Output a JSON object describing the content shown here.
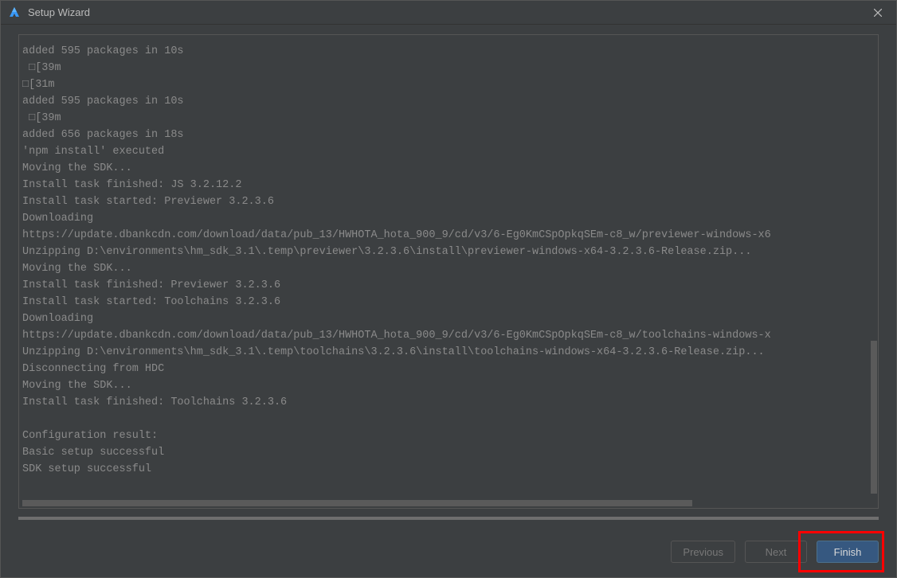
{
  "window": {
    "title": "Setup Wizard"
  },
  "log": {
    "lines": [
      "added 595 packages in 10s",
      " □[39m",
      "□[31m",
      "added 595 packages in 10s",
      " □[39m",
      "added 656 packages in 18s",
      "'npm install' executed",
      "Moving the SDK...",
      "Install task finished: JS 3.2.12.2",
      "Install task started: Previewer 3.2.3.6",
      "Downloading",
      "https://update.dbankcdn.com/download/data/pub_13/HWHOTA_hota_900_9/cd/v3/6-Eg0KmCSpOpkqSEm-c8_w/previewer-windows-x6",
      "Unzipping D:\\environments\\hm_sdk_3.1\\.temp\\previewer\\3.2.3.6\\install\\previewer-windows-x64-3.2.3.6-Release.zip...",
      "Moving the SDK...",
      "Install task finished: Previewer 3.2.3.6",
      "Install task started: Toolchains 3.2.3.6",
      "Downloading",
      "https://update.dbankcdn.com/download/data/pub_13/HWHOTA_hota_900_9/cd/v3/6-Eg0KmCSpOpkqSEm-c8_w/toolchains-windows-x",
      "Unzipping D:\\environments\\hm_sdk_3.1\\.temp\\toolchains\\3.2.3.6\\install\\toolchains-windows-x64-3.2.3.6-Release.zip...",
      "Disconnecting from HDC",
      "Moving the SDK...",
      "Install task finished: Toolchains 3.2.3.6",
      "",
      "Configuration result:",
      "Basic setup successful",
      "SDK setup successful"
    ]
  },
  "buttons": {
    "previous": "Previous",
    "next": "Next",
    "finish": "Finish"
  },
  "progress": {
    "percent": 100
  }
}
